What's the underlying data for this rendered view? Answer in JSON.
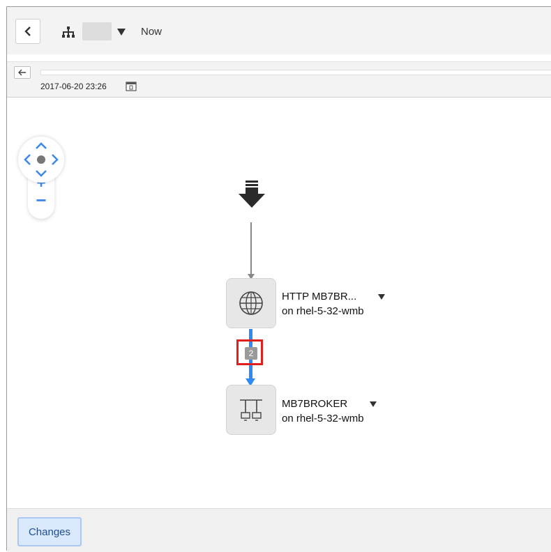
{
  "toolbar": {
    "back_icon": "chevron-left-icon",
    "hierarchy_icon": "hierarchy-icon",
    "dropdown_icon": "caret-down-icon",
    "time_mode": "Now"
  },
  "timeline": {
    "back_icon": "arrow-left-icon",
    "timestamp": "2017-06-20 23:26",
    "calendar_icon": "calendar-icon"
  },
  "navigation": {
    "pan_icon": "pan-icon",
    "zoom_in": "+",
    "zoom_out": "−"
  },
  "graph": {
    "entry_icon": "entry-arrow-icon",
    "nodes": [
      {
        "icon": "globe-icon",
        "title": "HTTP MB7BR...",
        "host": "on rhel-5-32-wmb"
      },
      {
        "icon": "broker-icon",
        "title": "MB7BROKER",
        "host": "on rhel-5-32-wmb"
      }
    ],
    "edge_count": "2"
  },
  "footer": {
    "changes_label": "Changes"
  },
  "colors": {
    "accent_blue": "#2f8af5",
    "highlight_red": "#e0201d",
    "button_bg": "#d9e9fb"
  }
}
